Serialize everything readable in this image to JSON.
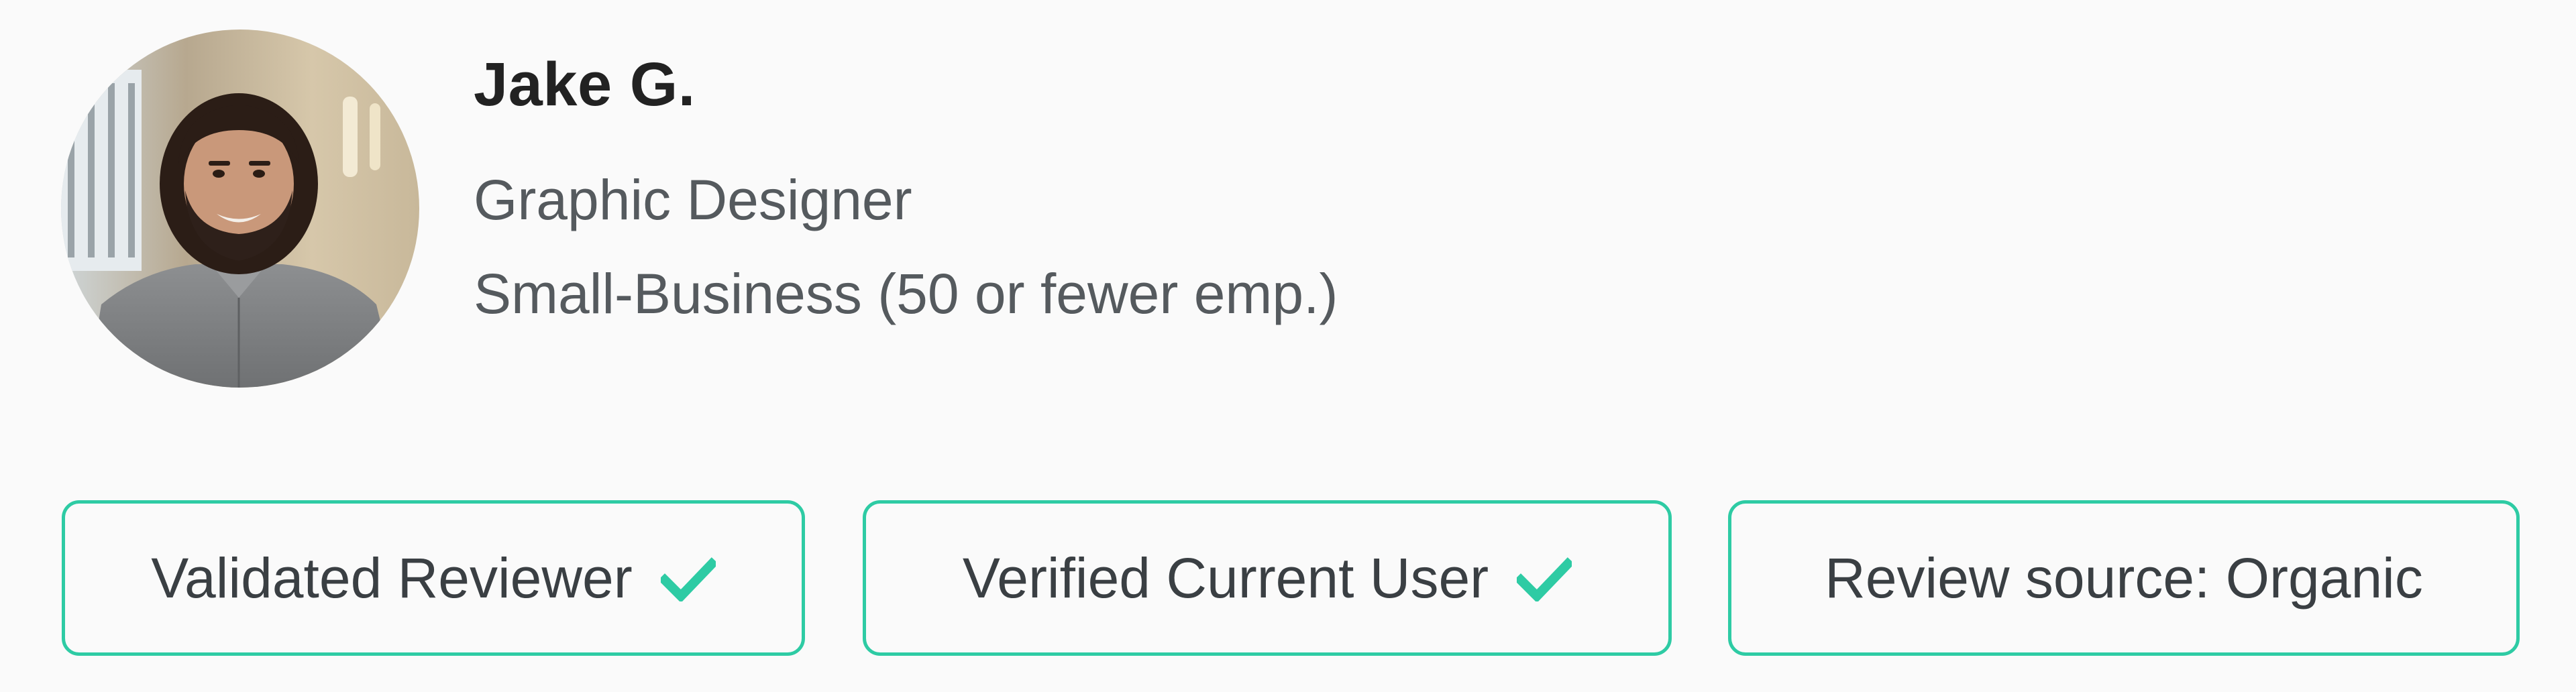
{
  "reviewer": {
    "name": "Jake G.",
    "title": "Graphic Designer",
    "company_size": "Small-Business (50 or fewer emp.)",
    "avatar_description": "reviewer-photo"
  },
  "badges": [
    {
      "label": "Validated Reviewer",
      "icon": "checkmark-icon"
    },
    {
      "label": "Verified Current User",
      "icon": "checkmark-icon"
    },
    {
      "label": "Review source: Organic",
      "icon": ""
    }
  ],
  "colors": {
    "accent": "#2ecba4",
    "name_text": "#222222",
    "secondary_text": "#555a5e",
    "background": "#fafafa"
  }
}
